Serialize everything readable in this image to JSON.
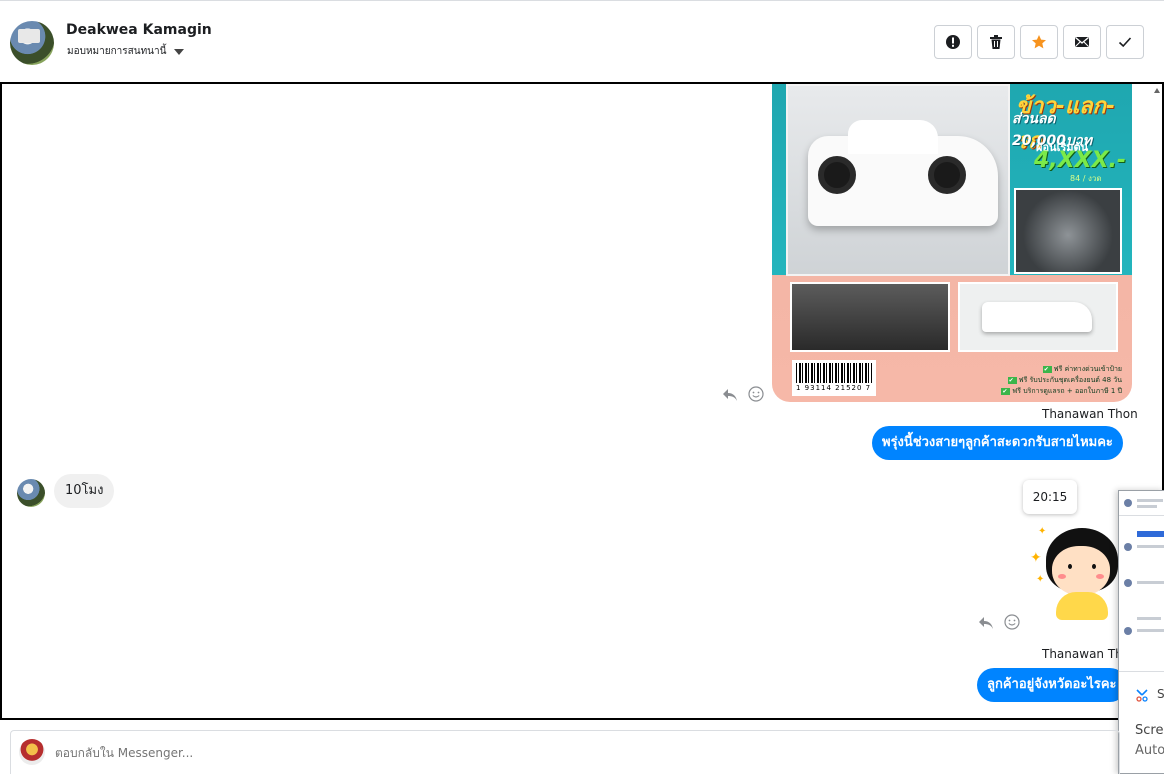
{
  "header": {
    "contact_name": "Deakwea Kamagin",
    "assign_label": "มอบหมายการสนทนานี้",
    "actions": [
      "spam-icon",
      "trash-icon",
      "star-icon",
      "envelope-icon",
      "check-icon"
    ],
    "star_color": "#f7931e"
  },
  "conversation": {
    "ad_image": {
      "promo_title": "ข้าว-แลก-รถ",
      "promo_discount": "ส่วนลด 20,000บาท",
      "promo_start": "ผ่อนเริ่มต้น",
      "promo_price": "4,XXX.-",
      "promo_period": "84 / งวด",
      "barcode_number": "1 93114 21520 7",
      "checks": [
        "ฟรี ค่าทางด่วนเข้าป้าย",
        "ฟรี รับประกันชุดเครื่องยนต์ 48 วัน",
        "ฟรี บริการดูแลรถ + ออกใบภาษี 1 ปี"
      ]
    },
    "sender_1": "Thanawan Thon",
    "outgoing_1": "พรุ่งนี้ช่วงสายๆลูกค้าสะดวกรับสายไหมคะ",
    "incoming_1": "10โมง",
    "timestamp_tooltip": "20:15",
    "sender_2": "Thanawan Thon",
    "outgoing_2": "ลูกค้าอยู่จังหวัดอะไรคะ"
  },
  "overlay": {
    "text_1": "S",
    "text_2": "Scree",
    "text_3": "Auto"
  },
  "composer": {
    "placeholder": "ตอบกลับใน Messenger..."
  },
  "colors": {
    "outgoing_bubble": "#0084ff",
    "incoming_bubble": "#f0f0f0"
  }
}
